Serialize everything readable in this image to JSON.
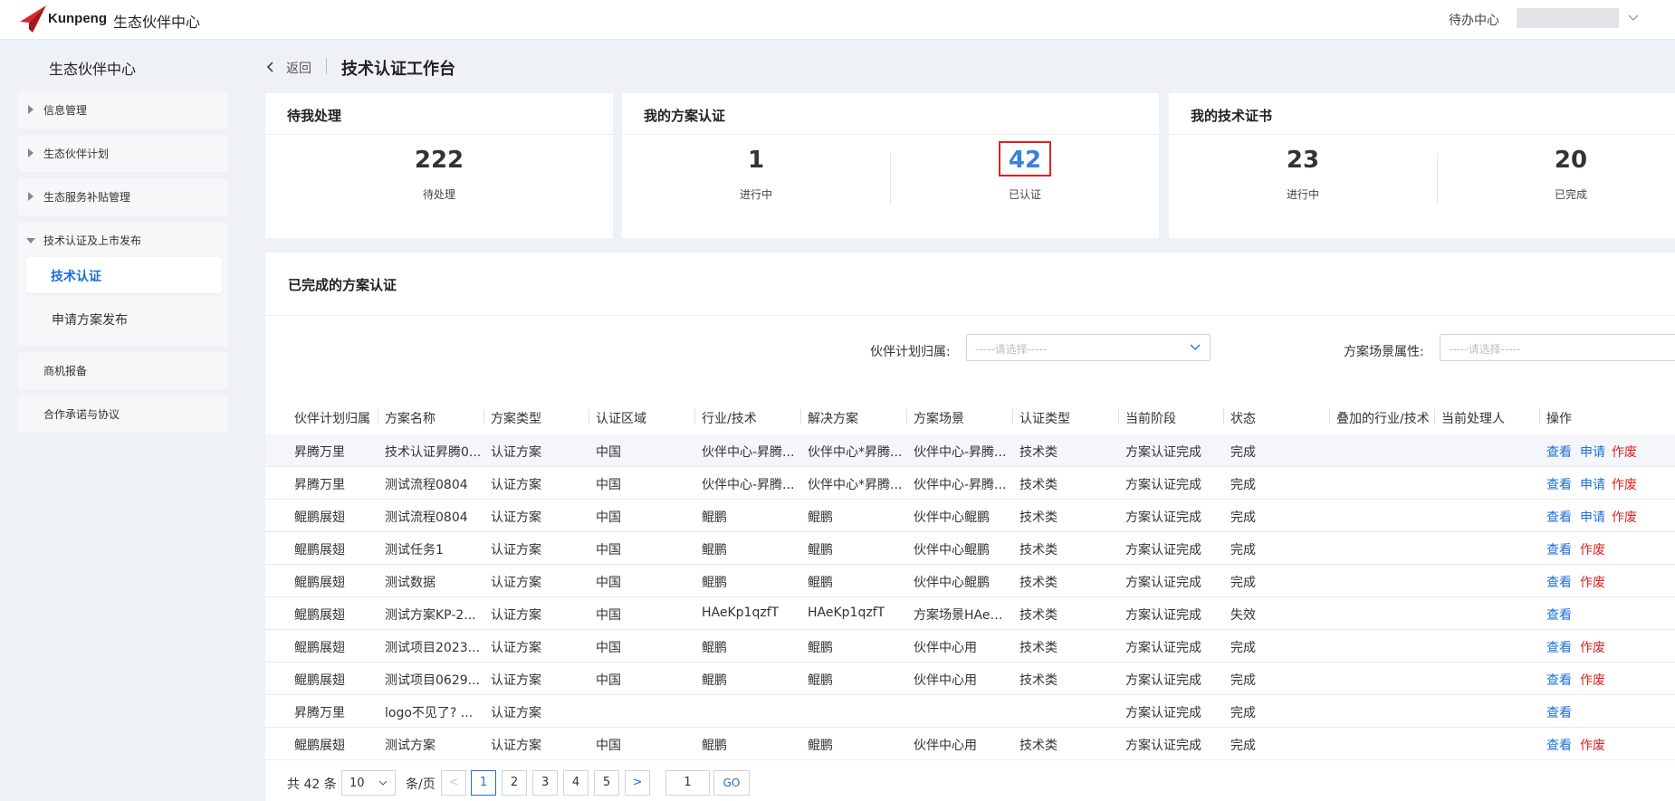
{
  "topbar": {
    "logo_text": "Kunpeng",
    "app_title": "生态伙伴中心",
    "todo_label": "待办中心",
    "brand_color": "#d8262f"
  },
  "sidebar": {
    "title": "生态伙伴中心",
    "items": [
      {
        "label": "信息管理"
      },
      {
        "label": "生态伙伴计划"
      },
      {
        "label": "生态服务补贴管理"
      },
      {
        "label": "技术认证及上市发布",
        "children": [
          {
            "label": "技术认证",
            "active": true
          },
          {
            "label": "申请方案发布"
          }
        ]
      },
      {
        "label": "商机报备"
      },
      {
        "label": "合作承诺与协议"
      }
    ]
  },
  "header": {
    "back_label": "返回",
    "page_title": "技术认证工作台"
  },
  "cards": [
    {
      "title": "待我处理",
      "stats": [
        {
          "value": "222",
          "label": "待处理"
        }
      ]
    },
    {
      "title": "我的方案认证",
      "stats": [
        {
          "value": "1",
          "label": "进行中"
        },
        {
          "value": "42",
          "label": "已认证"
        }
      ]
    },
    {
      "title": "我的技术证书",
      "stats": [
        {
          "value": "23",
          "label": "进行中"
        },
        {
          "value": "20",
          "label": "已完成"
        }
      ]
    }
  ],
  "panel": {
    "title": "已完成的方案认证",
    "filters": [
      {
        "label": "伙伴计划归属:",
        "placeholder": "-----请选择-----"
      },
      {
        "label": "方案场景属性:",
        "placeholder": "-----请选择-----"
      }
    ]
  },
  "table": {
    "columns": [
      "伙伴计划归属",
      "方案名称",
      "方案类型",
      "认证区域",
      "行业/技术",
      "解决方案",
      "方案场景",
      "认证类型",
      "当前阶段",
      "状态",
      "叠加的行业/技术",
      "当前处理人",
      "操作"
    ],
    "rows": [
      {
        "cells": [
          "昇腾万里",
          "技术认证昇腾0...",
          "认证方案",
          "中国",
          "伙伴中心-昇腾...",
          "伙伴中心*昇腾...",
          "伙伴中心-昇腾...",
          "技术类",
          "方案认证完成",
          "完成",
          "",
          ""
        ],
        "actions": [
          "查看",
          "申请",
          "作废"
        ]
      },
      {
        "cells": [
          "昇腾万里",
          "测试流程0804",
          "认证方案",
          "中国",
          "伙伴中心-昇腾...",
          "伙伴中心*昇腾...",
          "伙伴中心-昇腾...",
          "技术类",
          "方案认证完成",
          "完成",
          "",
          ""
        ],
        "actions": [
          "查看",
          "申请",
          "作废"
        ]
      },
      {
        "cells": [
          "鲲鹏展翅",
          "测试流程0804",
          "认证方案",
          "中国",
          "鲲鹏",
          "鲲鹏",
          "伙伴中心鲲鹏",
          "技术类",
          "方案认证完成",
          "完成",
          "",
          ""
        ],
        "actions": [
          "查看",
          "申请",
          "作废"
        ]
      },
      {
        "cells": [
          "鲲鹏展翅",
          "测试任务1",
          "认证方案",
          "中国",
          "鲲鹏",
          "鲲鹏",
          "伙伴中心鲲鹏",
          "技术类",
          "方案认证完成",
          "完成",
          "",
          ""
        ],
        "actions": [
          "查看",
          "作废"
        ]
      },
      {
        "cells": [
          "鲲鹏展翅",
          "测试数据",
          "认证方案",
          "中国",
          "鲲鹏",
          "鲲鹏",
          "伙伴中心鲲鹏",
          "技术类",
          "方案认证完成",
          "完成",
          "",
          ""
        ],
        "actions": [
          "查看",
          "作废"
        ]
      },
      {
        "cells": [
          "鲲鹏展翅",
          "测试方案KP-2...",
          "认证方案",
          "中国",
          "HAeKp1qzfT",
          "HAeKp1qzfT",
          "方案场景HAeK...",
          "技术类",
          "方案认证完成",
          "失效",
          "",
          ""
        ],
        "actions": [
          "查看"
        ]
      },
      {
        "cells": [
          "鲲鹏展翅",
          "测试项目2023...",
          "认证方案",
          "中国",
          "鲲鹏",
          "鲲鹏",
          "伙伴中心用",
          "技术类",
          "方案认证完成",
          "完成",
          "",
          ""
        ],
        "actions": [
          "查看",
          "作废"
        ]
      },
      {
        "cells": [
          "鲲鹏展翅",
          "测试项目0629...",
          "认证方案",
          "中国",
          "鲲鹏",
          "鲲鹏",
          "伙伴中心用",
          "技术类",
          "方案认证完成",
          "完成",
          "",
          ""
        ],
        "actions": [
          "查看",
          "作废"
        ]
      },
      {
        "cells": [
          "昇腾万里",
          "logo不见了? ...",
          "认证方案",
          "",
          "",
          "",
          "",
          "",
          "方案认证完成",
          "完成",
          "",
          ""
        ],
        "actions": [
          "查看"
        ]
      },
      {
        "cells": [
          "鲲鹏展翅",
          "测试方案",
          "认证方案",
          "中国",
          "鲲鹏",
          "鲲鹏",
          "伙伴中心用",
          "技术类",
          "方案认证完成",
          "完成",
          "",
          ""
        ],
        "actions": [
          "查看",
          "作废"
        ]
      }
    ]
  },
  "pagination": {
    "total": "共 42 条",
    "page_size": "10",
    "per_page_label": "条/页",
    "pages": [
      "1",
      "2",
      "3",
      "4",
      "5"
    ],
    "current_page": "1",
    "prev": "<",
    "next": ">",
    "jump_value": "1",
    "go_label": "GO"
  }
}
